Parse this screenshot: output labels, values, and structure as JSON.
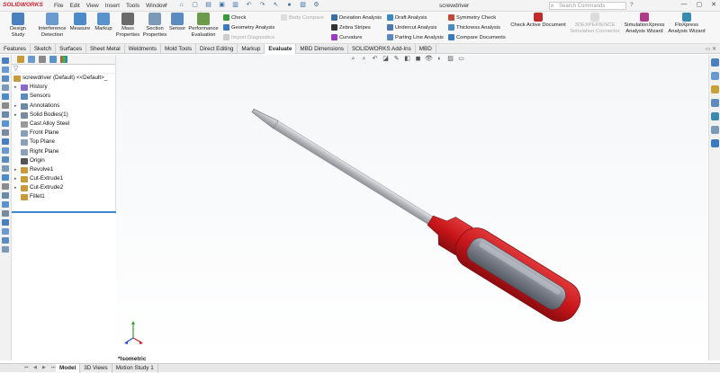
{
  "app": {
    "brand": "SOLIDWORKS",
    "document_title": "screwdriver"
  },
  "menu": [
    "File",
    "Edit",
    "View",
    "Insert",
    "Tools",
    "Window"
  ],
  "search": {
    "placeholder": "Search Commands"
  },
  "ribbon": {
    "big_buttons": [
      {
        "label": "Design Study",
        "color": "#4a7fc0"
      },
      {
        "label": "Interference Detection",
        "color": "#6a9ad0"
      },
      {
        "label": "Measure",
        "color": "#4c8ac8"
      },
      {
        "label": "Markup",
        "color": "#5a92cc"
      },
      {
        "label": "Mass Properties",
        "color": "#6a6a6a"
      },
      {
        "label": "Section Properties",
        "color": "#7a9ab8"
      },
      {
        "label": "Sensor",
        "color": "#5b8bbf"
      },
      {
        "label": "Performance Evaluation",
        "color": "#6a9a4a"
      }
    ],
    "check_group": [
      {
        "label": "Check",
        "dim": false,
        "color": "#3a9a3a"
      },
      {
        "label": "Geometry Analysis",
        "dim": false,
        "color": "#3a7ac0"
      },
      {
        "label": "Import Diagnostics",
        "dim": true,
        "color": "#bbbbbb"
      }
    ],
    "body_compare": "Body Compare",
    "analysis_col1": [
      {
        "label": "Deviation Analysis",
        "color": "#3a6ea5"
      },
      {
        "label": "Zebra Stripes",
        "color": "#333333"
      },
      {
        "label": "Curvature",
        "color": "#9a3ac0"
      }
    ],
    "analysis_col2": [
      {
        "label": "Draft Analysis",
        "color": "#3a8ac0"
      },
      {
        "label": "Undercut Analysis",
        "color": "#4a7ab0"
      },
      {
        "label": "Parting Line Analysis",
        "color": "#5a8ac0"
      }
    ],
    "analysis_col3": [
      {
        "label": "Symmetry Check",
        "color": "#c04a3a"
      },
      {
        "label": "Thickness Analysis",
        "color": "#4a8ac0"
      },
      {
        "label": "Compare Documents",
        "color": "#3a7ac0"
      }
    ],
    "right_buttons": [
      {
        "label": "Check Active Document",
        "dim": false,
        "color": "#c02a2a"
      },
      {
        "label": "3DEXPERIENCE Simulation Connector",
        "dim": true,
        "color": "#cccccc"
      },
      {
        "label": "SimulationXpress Analysis Wizard",
        "dim": false,
        "color": "#b03a8a"
      },
      {
        "label": "FloXpress Analysis Wizard",
        "dim": false,
        "color": "#3a8ab0"
      }
    ]
  },
  "tabs": [
    {
      "label": "Features",
      "active": false
    },
    {
      "label": "Sketch",
      "active": false
    },
    {
      "label": "Surfaces",
      "active": false
    },
    {
      "label": "Sheet Metal",
      "active": false
    },
    {
      "label": "Weldments",
      "active": false
    },
    {
      "label": "Mold Tools",
      "active": false
    },
    {
      "label": "Direct Editing",
      "active": false
    },
    {
      "label": "Markup",
      "active": false
    },
    {
      "label": "Evaluate",
      "active": true
    },
    {
      "label": "MBD Dimensions",
      "active": false
    },
    {
      "label": "SOLIDWORKS Add-Ins",
      "active": false
    },
    {
      "label": "MBD",
      "active": false
    }
  ],
  "feature_tree": {
    "root": "screwdriver (Default) <<Default>_",
    "items": [
      {
        "label": "History",
        "expand": true,
        "icon": "history-icon",
        "color": "#8a6ad0"
      },
      {
        "label": "Sensors",
        "expand": false,
        "icon": "sensor-icon",
        "color": "#5b8bbf"
      },
      {
        "label": "Annotations",
        "expand": true,
        "icon": "annotations-icon",
        "color": "#6a8aa8"
      },
      {
        "label": "Solid Bodies(1)",
        "expand": true,
        "icon": "solid-bodies-icon",
        "color": "#7a8aa0"
      },
      {
        "label": "Cast Alloy Steel",
        "expand": false,
        "icon": "material-icon",
        "color": "#9a9a9a"
      },
      {
        "label": "Front Plane",
        "expand": false,
        "icon": "plane-icon",
        "color": "#8aa0b8"
      },
      {
        "label": "Top Plane",
        "expand": false,
        "icon": "plane-icon",
        "color": "#8aa0b8"
      },
      {
        "label": "Right Plane",
        "expand": false,
        "icon": "plane-icon",
        "color": "#8aa0b8"
      },
      {
        "label": "Origin",
        "expand": false,
        "icon": "origin-icon",
        "color": "#555555"
      },
      {
        "label": "Revolve1",
        "expand": true,
        "icon": "revolve-icon",
        "color": "#c89a3a"
      },
      {
        "label": "Cut-Extrude1",
        "expand": true,
        "icon": "cut-extrude-icon",
        "color": "#c89a3a"
      },
      {
        "label": "Cut-Extrude2",
        "expand": true,
        "icon": "cut-extrude-icon",
        "color": "#c89a3a"
      },
      {
        "label": "Fillet1",
        "expand": false,
        "icon": "fillet-icon",
        "color": "#c89a3a"
      }
    ]
  },
  "viewport": {
    "view_label": "*Isometric"
  },
  "bottom_tabs": [
    {
      "label": "Model",
      "active": true
    },
    {
      "label": "3D Views",
      "active": false
    },
    {
      "label": "Motion Study 1",
      "active": false
    }
  ],
  "colors": {
    "handle_red": "#c8161b",
    "handle_grip": "#7a7f8a",
    "shaft": "#b9bcc0",
    "accent": "#d2202f"
  }
}
